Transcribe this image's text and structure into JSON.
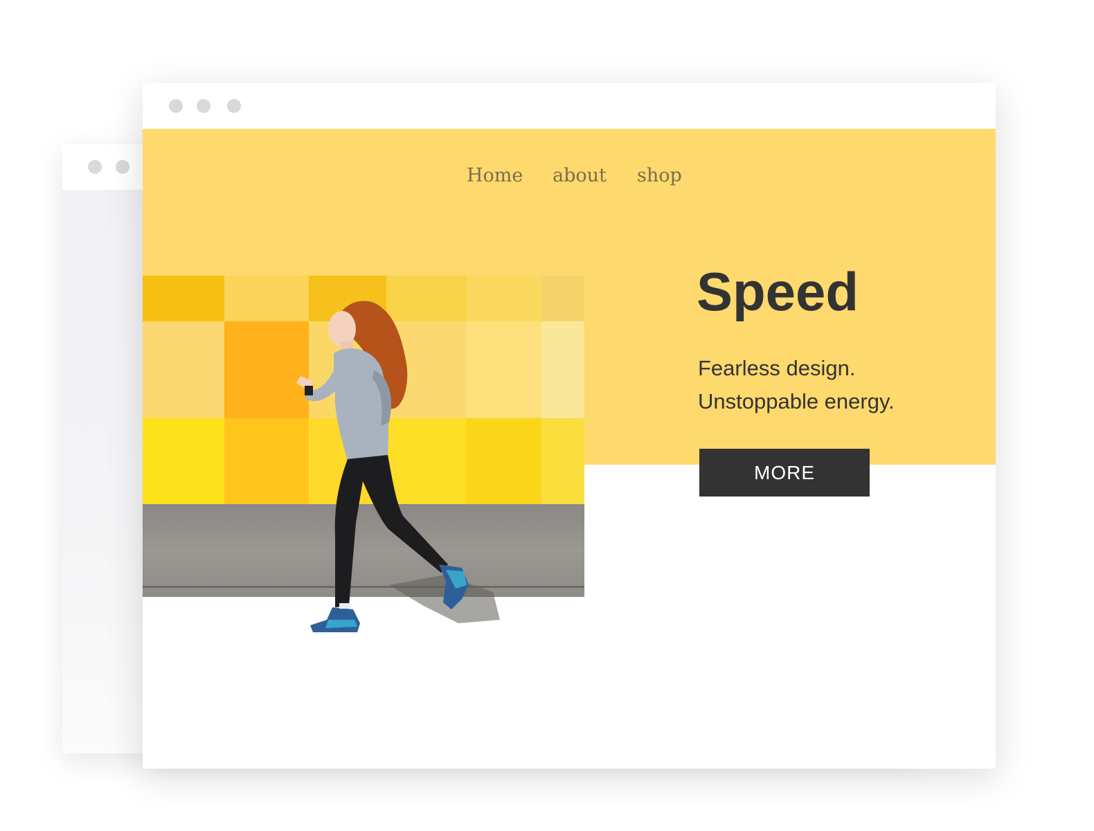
{
  "nav": {
    "items": [
      {
        "label": "Home"
      },
      {
        "label": "about"
      },
      {
        "label": "shop"
      }
    ]
  },
  "hero": {
    "headline": "Speed",
    "tagline_line1": "Fearless design.",
    "tagline_line2": "Unstoppable energy.",
    "button_label": "MORE"
  },
  "colors": {
    "hero_background": "#fed96d",
    "button_background": "#333333",
    "text": "#333333",
    "nav_text": "#7a6d4e"
  },
  "icons": [
    "window-dot-icon"
  ]
}
